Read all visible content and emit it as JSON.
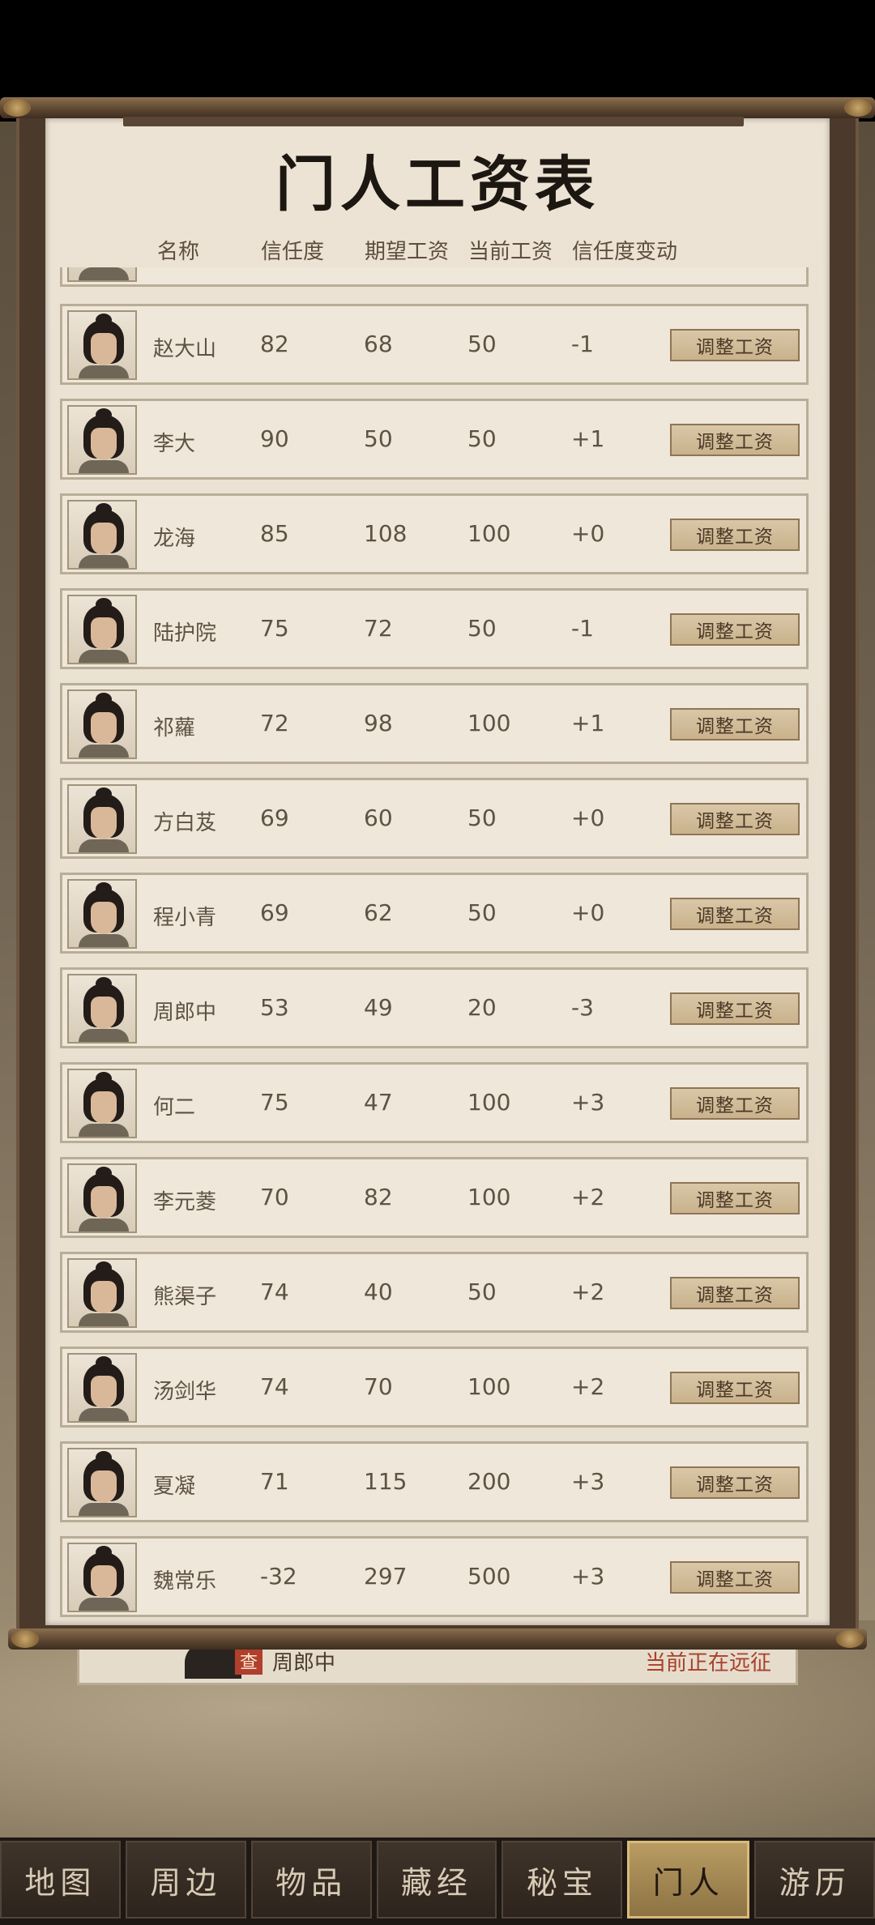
{
  "title": "门人工资表",
  "columns": {
    "name": "名称",
    "trust": "信任度",
    "expected": "期望工资",
    "current": "当前工资",
    "change": "信任度变动"
  },
  "button_label": "调整工资",
  "rows": [
    {
      "name": "赵大山",
      "trust": "82",
      "expected": "68",
      "current": "50",
      "change": "-1"
    },
    {
      "name": "李大",
      "trust": "90",
      "expected": "50",
      "current": "50",
      "change": "+1"
    },
    {
      "name": "龙海",
      "trust": "85",
      "expected": "108",
      "current": "100",
      "change": "+0"
    },
    {
      "name": "陆护院",
      "trust": "75",
      "expected": "72",
      "current": "50",
      "change": "-1"
    },
    {
      "name": "祁蘿",
      "trust": "72",
      "expected": "98",
      "current": "100",
      "change": "+1"
    },
    {
      "name": "方白芨",
      "trust": "69",
      "expected": "60",
      "current": "50",
      "change": "+0"
    },
    {
      "name": "程小青",
      "trust": "69",
      "expected": "62",
      "current": "50",
      "change": "+0"
    },
    {
      "name": "周郎中",
      "trust": "53",
      "expected": "49",
      "current": "20",
      "change": "-3"
    },
    {
      "name": "何二",
      "trust": "75",
      "expected": "47",
      "current": "100",
      "change": "+3"
    },
    {
      "name": "李元菱",
      "trust": "70",
      "expected": "82",
      "current": "100",
      "change": "+2"
    },
    {
      "name": "熊渠子",
      "trust": "74",
      "expected": "40",
      "current": "50",
      "change": "+2"
    },
    {
      "name": "汤剑华",
      "trust": "74",
      "expected": "70",
      "current": "100",
      "change": "+2"
    },
    {
      "name": "夏凝",
      "trust": "71",
      "expected": "115",
      "current": "200",
      "change": "+3"
    },
    {
      "name": "魏常乐",
      "trust": "-32",
      "expected": "297",
      "current": "500",
      "change": "+3"
    }
  ],
  "behind_card": {
    "badge": "查",
    "name": "周郎中",
    "status": "当前正在远征"
  },
  "nav": [
    {
      "label": "地图",
      "active": false
    },
    {
      "label": "周边",
      "active": false
    },
    {
      "label": "物品",
      "active": false
    },
    {
      "label": "藏经",
      "active": false
    },
    {
      "label": "秘宝",
      "active": false
    },
    {
      "label": "门人",
      "active": true
    },
    {
      "label": "游历",
      "active": false
    }
  ]
}
